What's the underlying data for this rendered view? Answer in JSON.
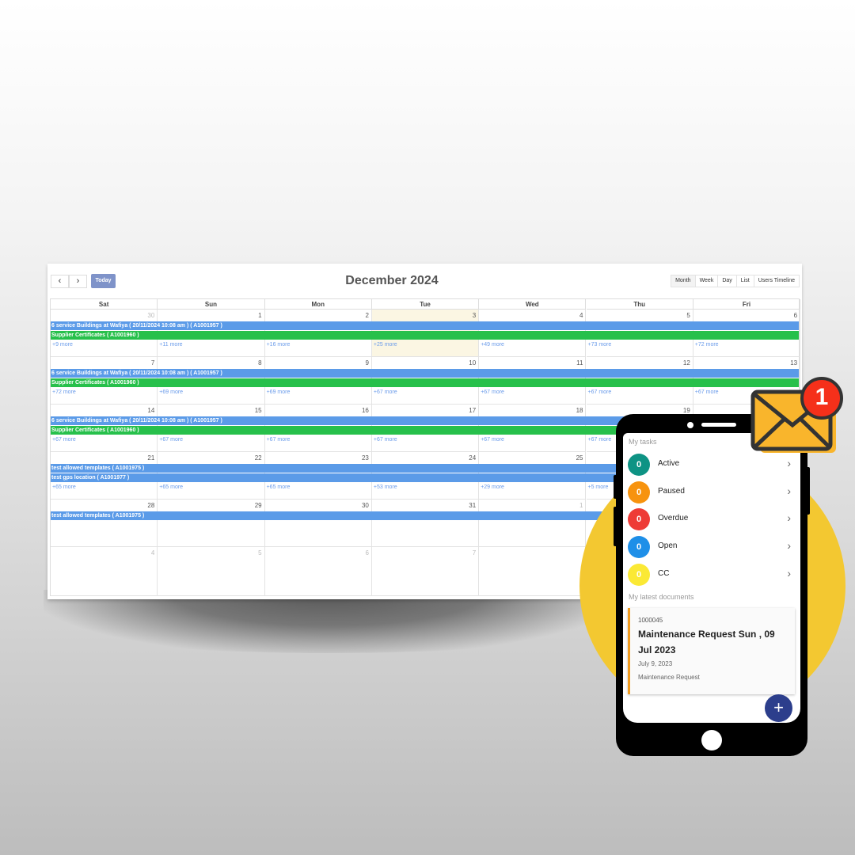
{
  "calendar": {
    "title": "December 2024",
    "today_label": "Today",
    "prev_icon": "‹",
    "next_icon": "›",
    "views": [
      "Month",
      "Week",
      "Day",
      "List",
      "Users Timeline"
    ],
    "weekdays": [
      "Sat",
      "Sun",
      "Mon",
      "Tue",
      "Wed",
      "Thu",
      "Fri"
    ],
    "today_highlight": "#fbf6e3",
    "weeks": [
      {
        "days": [
          {
            "n": "30",
            "muted": true
          },
          {
            "n": "1"
          },
          {
            "n": "2"
          },
          {
            "n": "3",
            "today": true
          },
          {
            "n": "4"
          },
          {
            "n": "5"
          },
          {
            "n": "6"
          }
        ],
        "events": [
          {
            "label": "6 service Buildings at Wafiya ( 20/11/2024 10:08 am ) ( A1001957 )",
            "color": "#5b9be8"
          },
          {
            "label": "Supplier Certificates ( A1001960 )",
            "color": "#27c04b"
          }
        ],
        "more": [
          "+9 more",
          "+11 more",
          "+16 more",
          "+25 more",
          "+49 more",
          "+73 more",
          "+72 more"
        ]
      },
      {
        "days": [
          {
            "n": "7"
          },
          {
            "n": "8"
          },
          {
            "n": "9"
          },
          {
            "n": "10"
          },
          {
            "n": "11"
          },
          {
            "n": "12"
          },
          {
            "n": "13"
          }
        ],
        "events": [
          {
            "label": "6 service Buildings at Wafiya ( 20/11/2024 10:08 am ) ( A1001957 )",
            "color": "#5b9be8"
          },
          {
            "label": "Supplier Certificates ( A1001960 )",
            "color": "#27c04b"
          }
        ],
        "more": [
          "+72 more",
          "+69 more",
          "+69 more",
          "+67 more",
          "+67 more",
          "+67 more",
          "+67 more"
        ]
      },
      {
        "days": [
          {
            "n": "14"
          },
          {
            "n": "15"
          },
          {
            "n": "16"
          },
          {
            "n": "17"
          },
          {
            "n": "18"
          },
          {
            "n": "19"
          },
          {
            "n": ""
          }
        ],
        "events": [
          {
            "label": "6 service Buildings at Wafiya ( 20/11/2024 10:08 am ) ( A1001957 )",
            "color": "#5b9be8"
          },
          {
            "label": "Supplier Certificates ( A1001960 )",
            "color": "#27c04b"
          }
        ],
        "more": [
          "+67 more",
          "+67 more",
          "+67 more",
          "+67 more",
          "+67 more",
          "+67 more",
          ""
        ]
      },
      {
        "days": [
          {
            "n": "21"
          },
          {
            "n": "22"
          },
          {
            "n": "23"
          },
          {
            "n": "24"
          },
          {
            "n": "25"
          },
          {
            "n": ""
          },
          {
            "n": ""
          }
        ],
        "events": [
          {
            "label": "test allowed templates ( A1001975 )",
            "color": "#5b9be8"
          },
          {
            "label": "test gps location ( A1001977 )",
            "color": "#5b9be8"
          }
        ],
        "more": [
          "+65 more",
          "+65 more",
          "+65 more",
          "+53 more",
          "+29 more",
          "+5 more",
          ""
        ]
      },
      {
        "days": [
          {
            "n": "28"
          },
          {
            "n": "29"
          },
          {
            "n": "30"
          },
          {
            "n": "31"
          },
          {
            "n": "1",
            "muted": true
          },
          {
            "n": ""
          },
          {
            "n": ""
          }
        ],
        "events": [
          {
            "label": "test allowed templates ( A1001975 )",
            "color": "#5b9be8"
          }
        ],
        "more": [
          "",
          "",
          "",
          "",
          "",
          "",
          ""
        ]
      },
      {
        "days": [
          {
            "n": "4",
            "muted": true
          },
          {
            "n": "5",
            "muted": true
          },
          {
            "n": "6",
            "muted": true
          },
          {
            "n": "7",
            "muted": true
          },
          {
            "n": "",
            "muted": true
          },
          {
            "n": ""
          },
          {
            "n": ""
          }
        ],
        "events": [],
        "more": [
          "",
          "",
          "",
          "",
          "",
          "",
          ""
        ]
      }
    ]
  },
  "phone": {
    "tasks_heading": "My tasks",
    "tasks": [
      {
        "count": "0",
        "label": "Active",
        "color": "#0e9384"
      },
      {
        "count": "0",
        "label": "Paused",
        "color": "#f7930e"
      },
      {
        "count": "0",
        "label": "Overdue",
        "color": "#ee3b36"
      },
      {
        "count": "0",
        "label": "Open",
        "color": "#1e8fe8"
      },
      {
        "count": "0",
        "label": "CC",
        "color": "#fbe935"
      }
    ],
    "docs_heading": "My latest documents",
    "doc": {
      "id": "1000045",
      "title": "Maintenance Request Sun , 09 Jul 2023",
      "date": "July 9, 2023",
      "type": "Maintenance Request"
    },
    "fab_icon": "+",
    "notification_count": "1"
  }
}
